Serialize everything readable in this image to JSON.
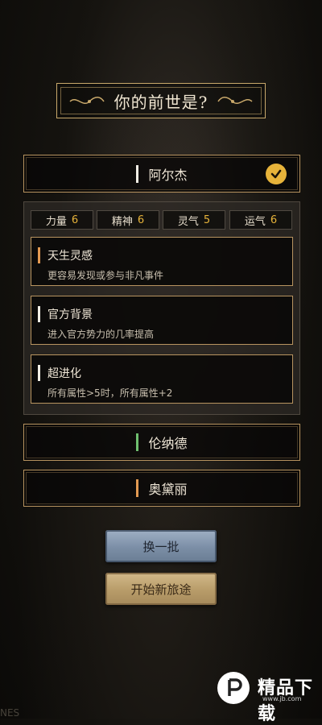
{
  "title": "你的前世是?",
  "options": [
    {
      "name": "阿尔杰",
      "accent": "#f2efe6",
      "selected": true
    },
    {
      "name": "伦纳德",
      "accent": "#6fbf6f",
      "selected": false
    },
    {
      "name": "奥黛丽",
      "accent": "#e39a52",
      "selected": false
    }
  ],
  "stats": [
    {
      "label": "力量",
      "value": "6"
    },
    {
      "label": "精神",
      "value": "6"
    },
    {
      "label": "灵气",
      "value": "5"
    },
    {
      "label": "运气",
      "value": "6"
    }
  ],
  "traits": [
    {
      "name": "天生灵感",
      "desc": "更容易发现或参与非凡事件",
      "accent": "#e39a52"
    },
    {
      "name": "官方背景",
      "desc": "进入官方势力的几率提高",
      "accent": "#f2efe6"
    },
    {
      "name": "超进化",
      "desc": "所有属性>5时，所有属性+2",
      "accent": "#f2efe6"
    }
  ],
  "buttons": {
    "refresh": "换一批",
    "start": "开始新旅途"
  },
  "watermark": {
    "text": "精品下载",
    "sub": "www.jb.com"
  },
  "corner_text": "NES",
  "colors": {
    "gold": "#e7b33a",
    "border": "#b89460"
  }
}
